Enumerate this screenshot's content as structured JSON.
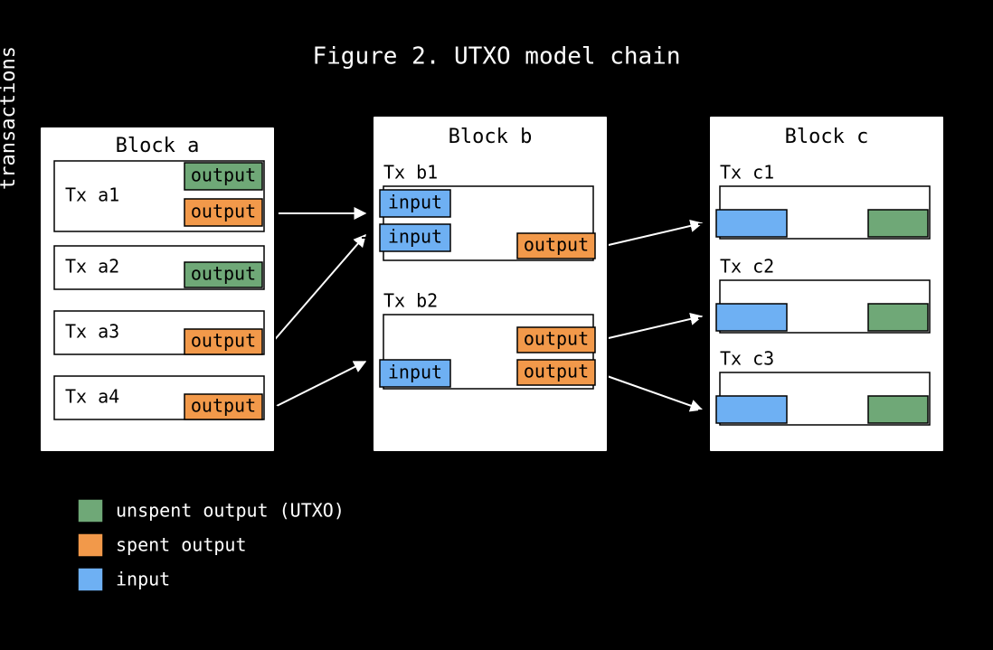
{
  "title": "Figure 2. UTXO model chain",
  "rows": {
    "transactions": "transactions"
  },
  "blocks": {
    "a": {
      "title": "Block a",
      "txs": [
        {
          "label": "Tx a1",
          "outputs": [
            {
              "color": "green",
              "text": "output",
              "spent": false
            },
            {
              "color": "orange",
              "text": "output",
              "spent": true
            }
          ]
        },
        {
          "label": "Tx a2",
          "outputs": [
            {
              "color": "green",
              "text": "output",
              "spent": false
            }
          ]
        },
        {
          "label": "Tx a3",
          "outputs": [
            {
              "color": "orange",
              "text": "output",
              "spent": true
            }
          ]
        },
        {
          "label": "Tx a4",
          "outputs": [
            {
              "color": "orange",
              "text": "output",
              "spent": true
            }
          ]
        }
      ]
    },
    "b": {
      "title": "Block b",
      "txs": [
        {
          "label": "Tx b1",
          "inputs": [
            {
              "text": "input"
            },
            {
              "text": "input"
            }
          ],
          "outputs": [
            {
              "color": "orange",
              "text": "output",
              "spent": true
            }
          ]
        },
        {
          "label": "Tx b2",
          "inputs": [
            {
              "text": "input"
            }
          ],
          "outputs": [
            {
              "color": "orange",
              "text": "output",
              "spent": true
            },
            {
              "color": "orange",
              "text": "output",
              "spent": true
            }
          ]
        }
      ]
    },
    "c": {
      "title": "Block c",
      "txs": [
        {
          "label": "Tx c1",
          "inputs": [
            {}
          ],
          "outputs": [
            {
              "color": "green"
            }
          ]
        },
        {
          "label": "Tx c2",
          "inputs": [
            {}
          ],
          "outputs": [
            {
              "color": "green"
            }
          ]
        },
        {
          "label": "Tx c3",
          "inputs": [
            {}
          ],
          "outputs": [
            {
              "color": "green"
            }
          ]
        }
      ]
    }
  },
  "legend": {
    "unspent": "unspent output (UTXO)",
    "spent": "spent output",
    "input": "input"
  },
  "colors": {
    "green": "#6FA877",
    "orange": "#F2994A",
    "blue": "#6EB0F3",
    "stroke": "#000000"
  }
}
